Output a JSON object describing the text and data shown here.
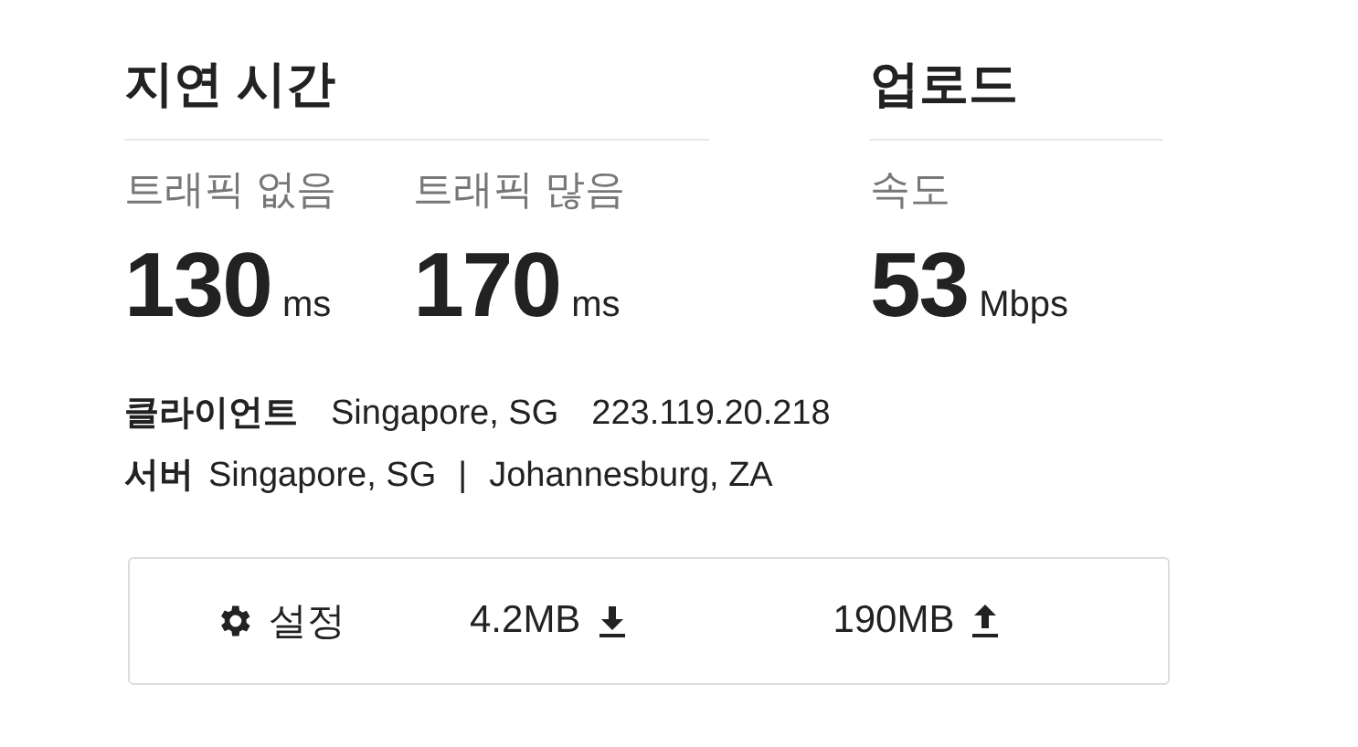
{
  "latency": {
    "title": "지연 시간",
    "metrics": [
      {
        "label": "트래픽 없음",
        "value": "130",
        "unit": "ms"
      },
      {
        "label": "트래픽 많음",
        "value": "170",
        "unit": "ms"
      }
    ]
  },
  "upload": {
    "title": "업로드",
    "metrics": [
      {
        "label": "속도",
        "value": "53",
        "unit": "Mbps"
      }
    ]
  },
  "client": {
    "label": "클라이언트",
    "location": "Singapore, SG",
    "ip": "223.119.20.218"
  },
  "server": {
    "label": "서버",
    "location": "Singapore, SG",
    "separator": "|",
    "destination": "Johannesburg, ZA"
  },
  "footer": {
    "settings": "설정",
    "download": "4.2MB",
    "upload": "190MB"
  }
}
